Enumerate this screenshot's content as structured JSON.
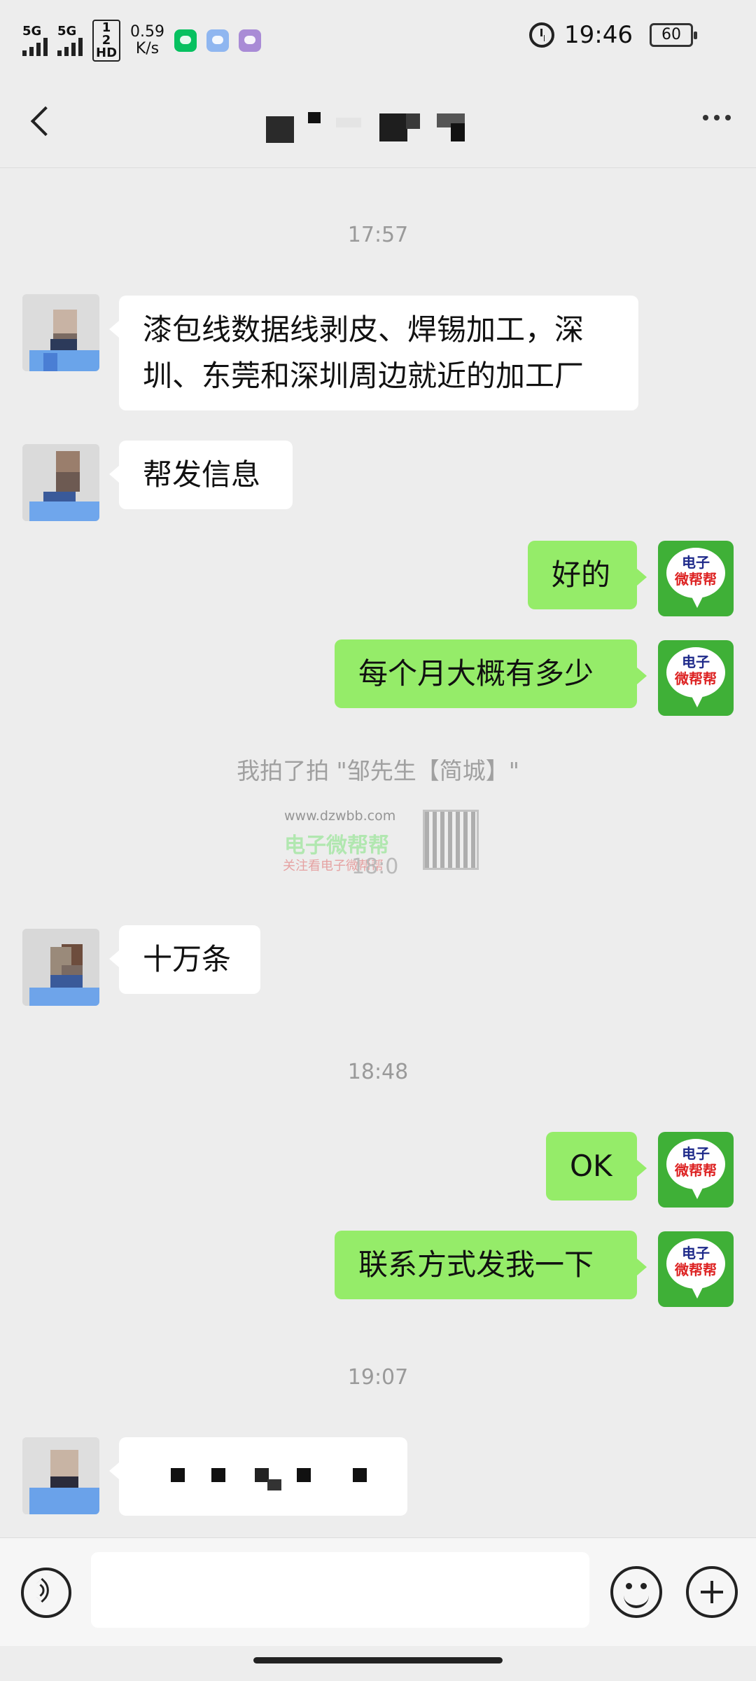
{
  "status_bar": {
    "network1": "5G",
    "network2": "5G",
    "hd_badge": "1 2\nHD",
    "speed_value": "0.59",
    "speed_unit": "K/s",
    "time": "19:46",
    "battery": "60",
    "icons": [
      "wechat-icon",
      "message-icon",
      "app-icon",
      "alarm-icon"
    ]
  },
  "nav": {
    "back_icon": "chevron-left-icon",
    "title": "",
    "more_icon": "more-dots-icon"
  },
  "messages": {
    "t1": "17:57",
    "m1": "漆包线数据线剥皮、焊锡加工，深圳、东莞和深圳周边就近的加工厂",
    "m2": "帮发信息",
    "m3": "好的",
    "m4": "每个月大概有多少",
    "sys1": "我拍了拍 \"邹先生【简城】\"",
    "m5": "十万条",
    "t3": "18:48",
    "m6": "OK",
    "m7": "联系方式发我一下",
    "t4": "19:07",
    "m8": ""
  },
  "my_avatar": {
    "line1": "电子",
    "line2": "微帮帮"
  },
  "watermark": {
    "url": "www.dzwbb.com",
    "brand": "电子微帮帮",
    "sub": "关注看电子微帮帮",
    "covered_time": "18:0"
  },
  "input_bar": {
    "voice_icon": "voice-icon",
    "emoji_icon": "emoji-icon",
    "plus_icon": "plus-icon",
    "text_value": ""
  },
  "colors": {
    "background": "#ededed",
    "outgoing_bubble": "#95ec69",
    "incoming_bubble": "#ffffff",
    "timestamp": "#9a9a9a"
  }
}
